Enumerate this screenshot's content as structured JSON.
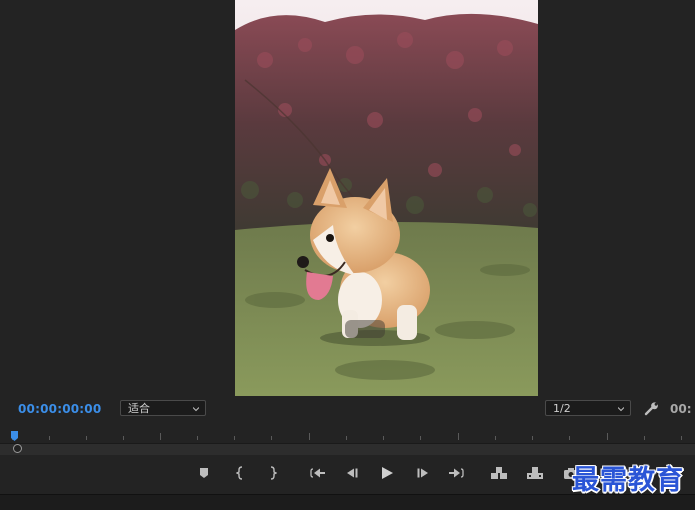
{
  "monitor": {
    "timecode_current": "00:00:00:00",
    "timecode_duration": "00:",
    "zoom_level": "适合",
    "playback_resolution": "1/2"
  },
  "colors": {
    "background": "#232323",
    "timecode_accent": "#3b8ee8",
    "watermark": "#2a55d6"
  },
  "transport": {
    "buttons": [
      "add-marker",
      "mark-in",
      "mark-out",
      "go-to-in",
      "step-back",
      "play",
      "step-forward",
      "go-to-out",
      "insert",
      "overwrite",
      "export-frame"
    ]
  },
  "watermark": {
    "text": "最需教育"
  }
}
